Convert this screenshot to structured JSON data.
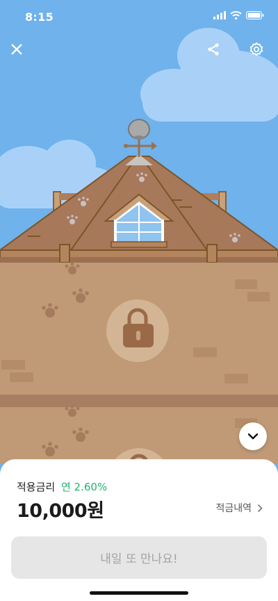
{
  "status_bar": {
    "time": "8:15"
  },
  "icons": {
    "close": "close-icon",
    "share": "share-icon",
    "settings": "gear-icon",
    "lock": "lock-icon",
    "scroll_down": "chevron-down-icon",
    "history_arrow": "chevron-right-icon"
  },
  "savings": {
    "rate_label": "적용금리",
    "rate_value": "연 2.60%",
    "amount": "10,000원",
    "history_label": "적금내역"
  },
  "action": {
    "button_label": "내일 또 만나요!"
  },
  "colors": {
    "sky": "#6fb2ec",
    "roof": "#a8785a",
    "wall": "#c09a76",
    "rate_green": "#1fb56a",
    "button_disabled": "#e6e6e6"
  }
}
